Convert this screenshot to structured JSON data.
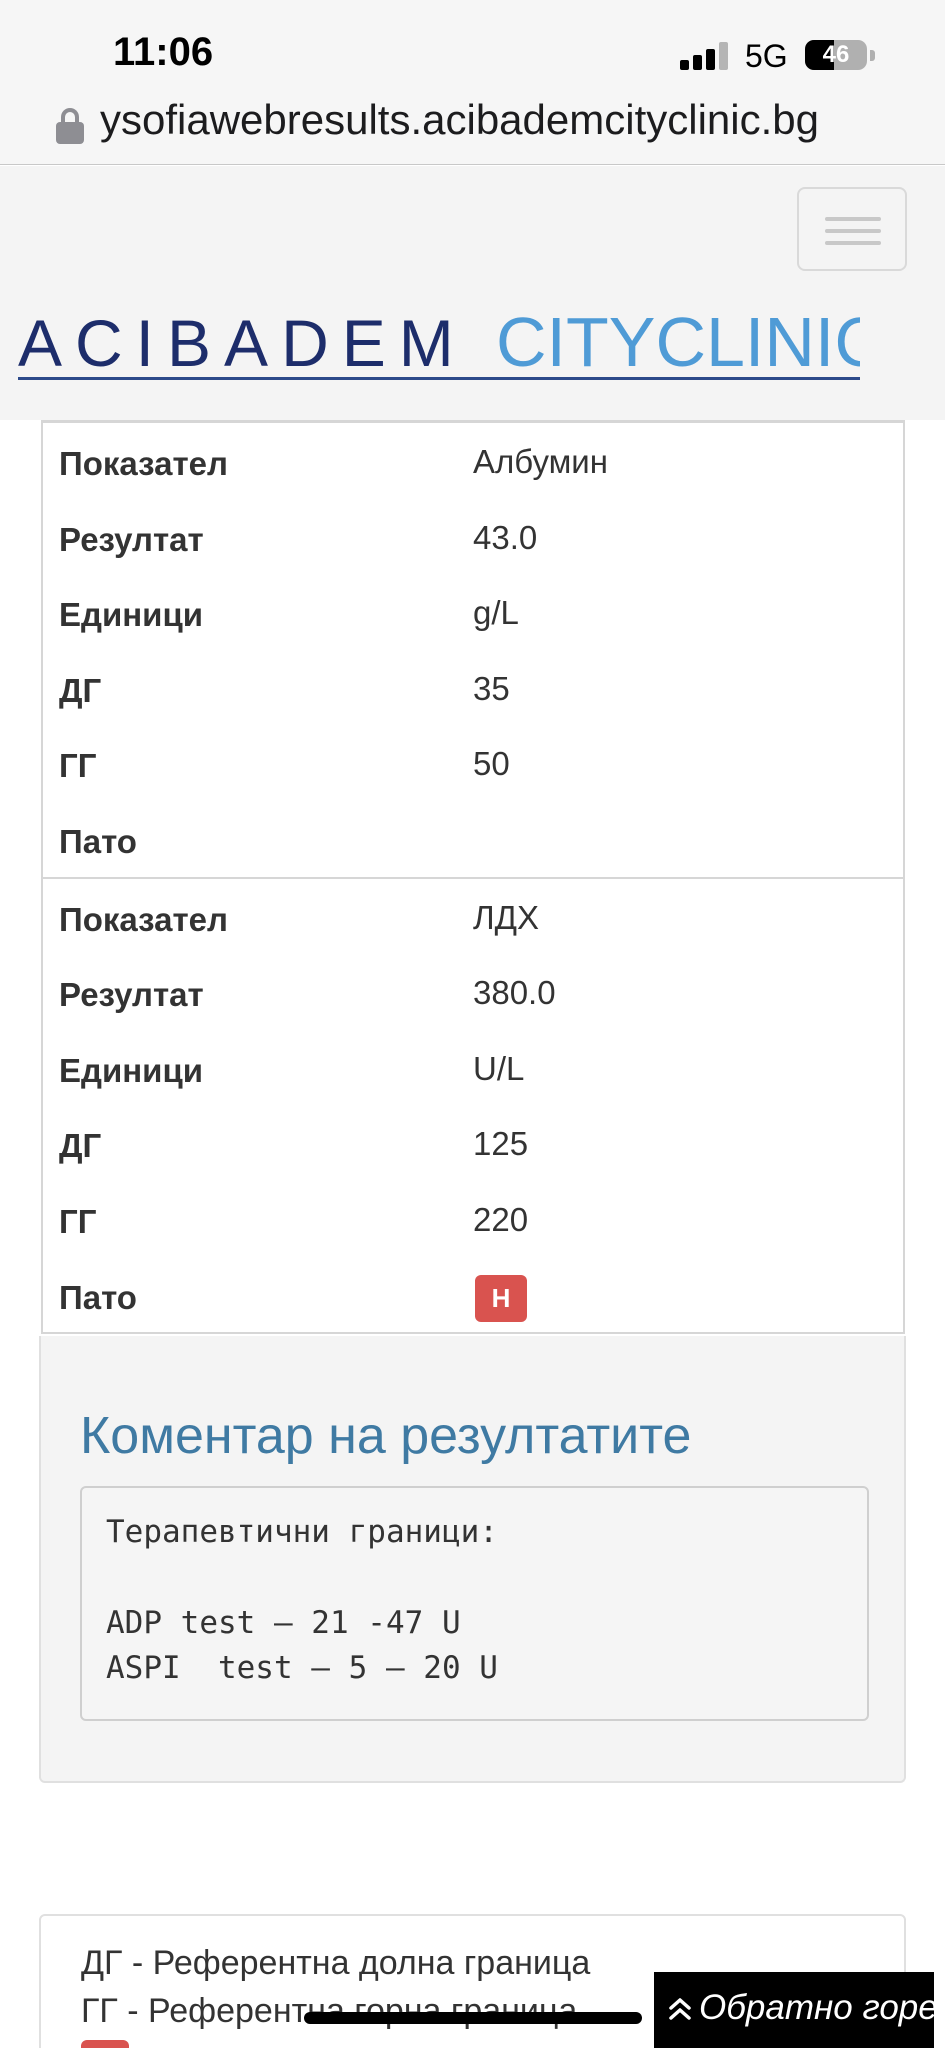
{
  "status_bar": {
    "time": "11:06",
    "network": "5G",
    "battery_level": "46",
    "battery_fraction": 0.46
  },
  "browser": {
    "url": "ysofiawebresults.acibademcityclinic.bg"
  },
  "header": {
    "logo_left": "ACIBADEM",
    "logo_right": "CITYCLINIC",
    "brand_navy": "#1d2d6b",
    "brand_blue": "#4f9bd6"
  },
  "results": [
    {
      "rows": [
        {
          "label": "Показател",
          "value": "Албумин"
        },
        {
          "label": "Резултат",
          "value": "43.0"
        },
        {
          "label": "Единици",
          "value": "g/L"
        },
        {
          "label": "ДГ",
          "value": "35"
        },
        {
          "label": "ГГ",
          "value": "50"
        },
        {
          "label": "Пато",
          "value": ""
        }
      ]
    },
    {
      "rows": [
        {
          "label": "Показател",
          "value": "ЛДХ"
        },
        {
          "label": "Резултат",
          "value": "380.0"
        },
        {
          "label": "Единици",
          "value": "U/L"
        },
        {
          "label": "ДГ",
          "value": "125"
        },
        {
          "label": "ГГ",
          "value": "220"
        },
        {
          "label": "Пато",
          "value": "",
          "badge": "H"
        }
      ]
    }
  ],
  "comment": {
    "title": "Коментар на резултатите",
    "lines": [
      "Терапевтични граници:",
      "",
      "ADP test – 21 -47 U",
      "ASPI  test – 5 – 20 U"
    ]
  },
  "legend": {
    "lines": [
      "ДГ - Референтна долна граница",
      "ГГ - Референтна горна граница"
    ],
    "badge_color": "#d9534f"
  },
  "back_to_top": {
    "label": "Обратно горе",
    "icon": "double-chevron-up-icon"
  }
}
